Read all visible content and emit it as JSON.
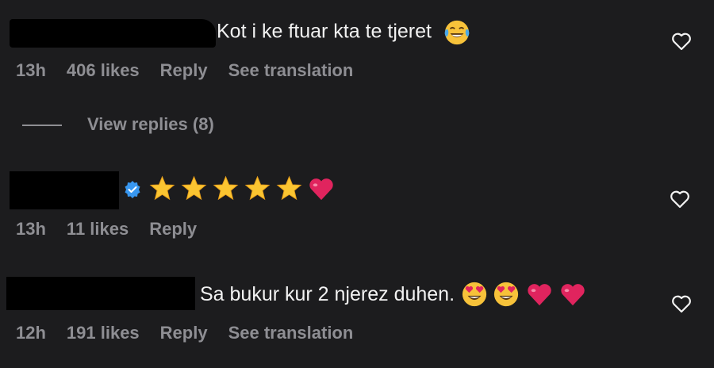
{
  "comments": [
    {
      "text": "Kot i ke ftuar kta te tjeret",
      "time": "13h",
      "likes": "406 likes",
      "reply": "Reply",
      "translate": "See translation"
    },
    {
      "text": "",
      "time": "13h",
      "likes": "11 likes",
      "reply": "Reply"
    },
    {
      "text": "Sa bukur kur 2 njerez duhen.",
      "time": "12h",
      "likes": "191 likes",
      "reply": "Reply",
      "translate": "See translation"
    }
  ],
  "view_replies": "View replies (8)",
  "icons": {
    "like": "heart-outline-icon",
    "verified": "verified-badge-icon",
    "laughing": "face-with-tears-of-joy-emoji",
    "star": "star-emoji",
    "red_heart": "red-heart-emoji",
    "heart_eyes": "heart-eyes-emoji"
  },
  "colors": {
    "background": "#1c1c1e",
    "text": "#f2f2f2",
    "meta": "#8e8e93",
    "verified": "#3897f0"
  }
}
